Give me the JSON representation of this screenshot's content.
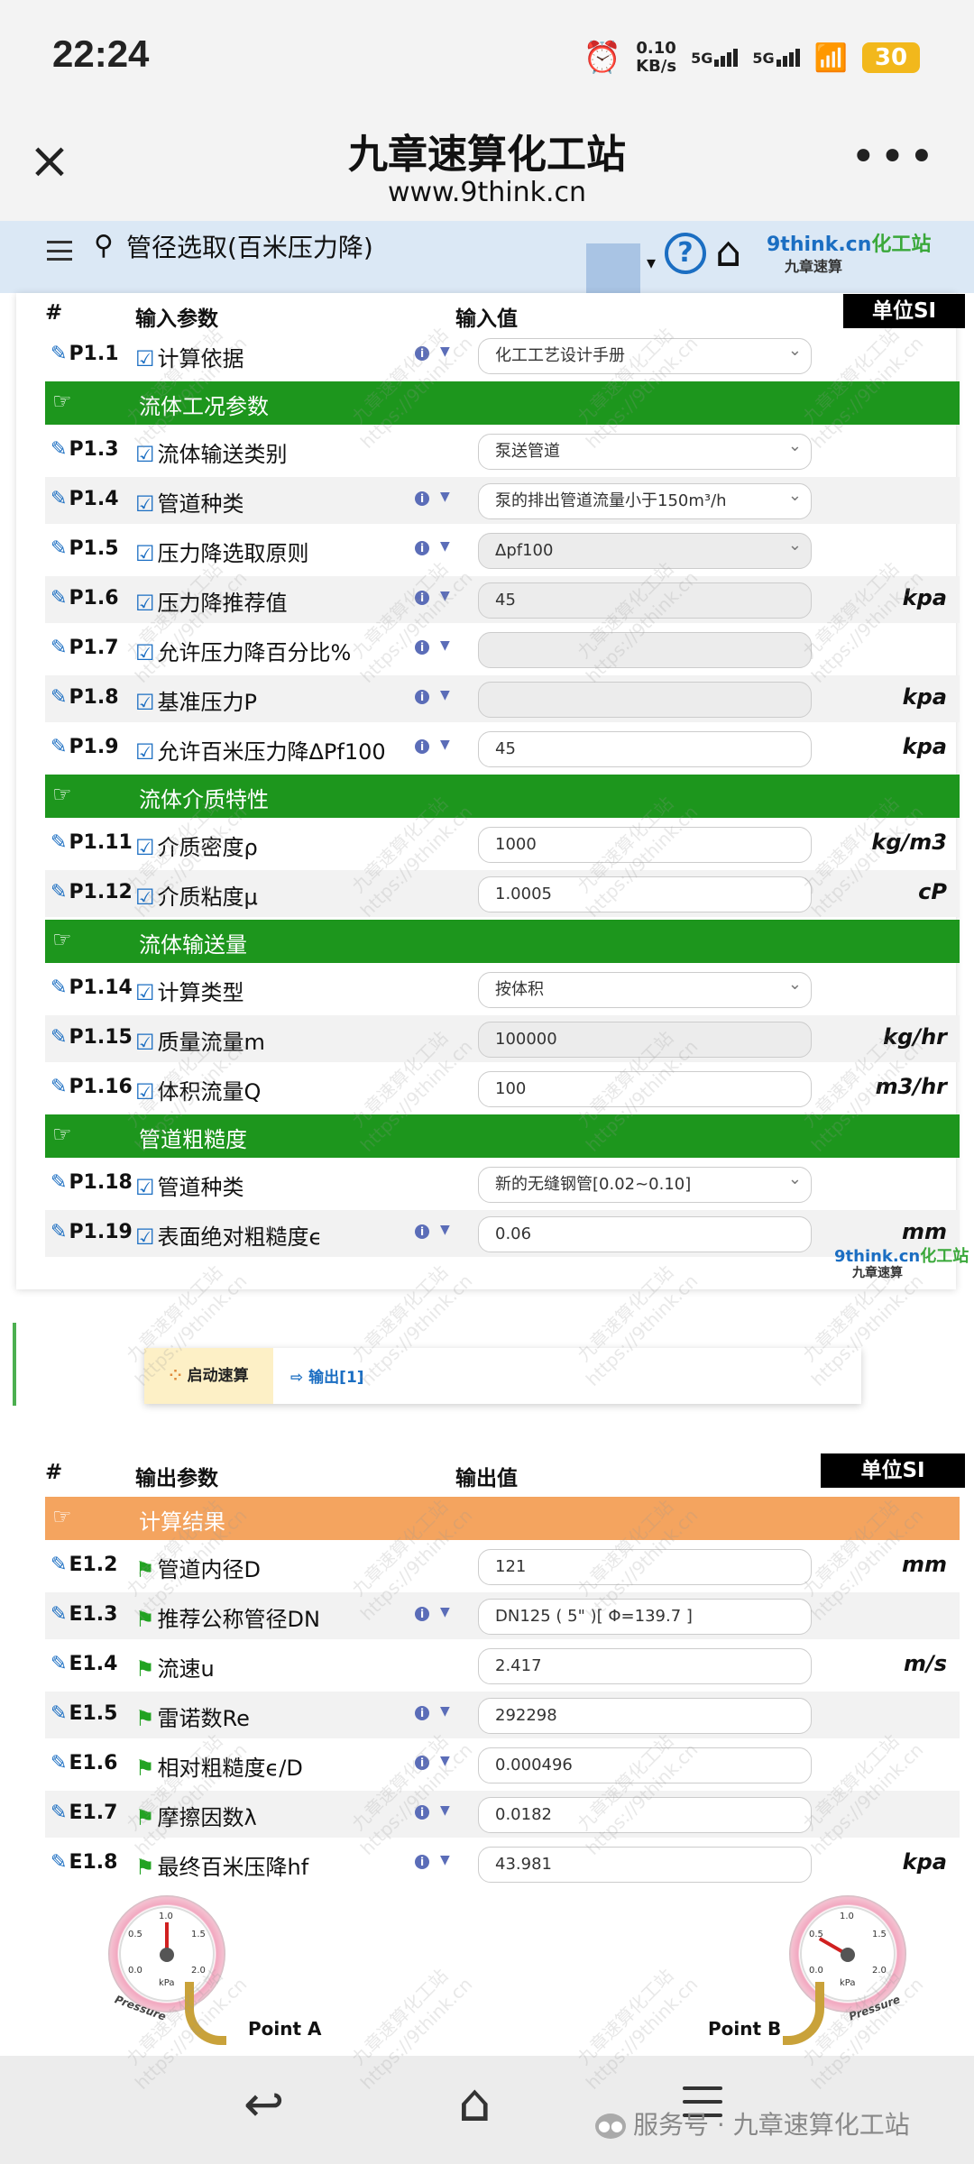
{
  "status": {
    "time": "22:24",
    "speed": "0.10",
    "speed_unit": "KB/s",
    "net1": "5G",
    "net2": "5G",
    "battery": "30"
  },
  "titlebar": {
    "title": "九章速算化工站",
    "subtitle": "www.9think.cn"
  },
  "appbar": {
    "title": "管径选取(百米压力降)",
    "logo_main": "9think.cn",
    "logo_suffix": "化工站",
    "logo_sub": "九章速算",
    "help": "?"
  },
  "input_header": {
    "col_id": "#",
    "col_param": "输入参数",
    "col_value": "输入值",
    "unit": "单位SI"
  },
  "inputs": [
    {
      "type": "row",
      "id": "P1.1",
      "name": "计算依据",
      "info": true,
      "value": "化工工艺设计手册",
      "select": true,
      "ro": false,
      "unit": ""
    },
    {
      "type": "section",
      "name": "流体工况参数"
    },
    {
      "type": "row",
      "id": "P1.3",
      "name": "流体输送类别",
      "info": false,
      "value": "泵送管道",
      "select": true,
      "ro": false,
      "unit": ""
    },
    {
      "type": "row",
      "id": "P1.4",
      "name": "管道种类",
      "info": true,
      "value": "泵的排出管道流量小于150m³/h",
      "select": true,
      "ro": false,
      "unit": ""
    },
    {
      "type": "row",
      "id": "P1.5",
      "name": "压力降选取原则",
      "info": true,
      "value": "Δpf100",
      "select": true,
      "ro": true,
      "unit": ""
    },
    {
      "type": "row",
      "id": "P1.6",
      "name": "压力降推荐值",
      "info": true,
      "value": "45",
      "select": false,
      "ro": true,
      "unit": "kpa"
    },
    {
      "type": "row",
      "id": "P1.7",
      "name": "允许压力降百分比%",
      "info": true,
      "value": "",
      "select": false,
      "ro": true,
      "unit": ""
    },
    {
      "type": "row",
      "id": "P1.8",
      "name": "基准压力P",
      "info": true,
      "value": "",
      "select": false,
      "ro": true,
      "unit": "kpa"
    },
    {
      "type": "row",
      "id": "P1.9",
      "name": "允许百米压力降ΔPf100",
      "info": true,
      "value": "45",
      "select": false,
      "ro": false,
      "unit": "kpa"
    },
    {
      "type": "section",
      "name": "流体介质特性"
    },
    {
      "type": "row",
      "id": "P1.11",
      "name": "介质密度ρ",
      "info": false,
      "value": "1000",
      "select": false,
      "ro": false,
      "unit": "kg/m3"
    },
    {
      "type": "row",
      "id": "P1.12",
      "name": "介质粘度μ",
      "info": false,
      "value": "1.0005",
      "select": false,
      "ro": false,
      "unit": "cP"
    },
    {
      "type": "section",
      "name": "流体输送量"
    },
    {
      "type": "row",
      "id": "P1.14",
      "name": "计算类型",
      "info": false,
      "value": "按体积",
      "select": true,
      "ro": false,
      "unit": ""
    },
    {
      "type": "row",
      "id": "P1.15",
      "name": "质量流量m",
      "info": false,
      "value": "100000",
      "select": false,
      "ro": true,
      "unit": "kg/hr"
    },
    {
      "type": "row",
      "id": "P1.16",
      "name": "体积流量Q",
      "info": false,
      "value": "100",
      "select": false,
      "ro": false,
      "unit": "m3/hr"
    },
    {
      "type": "section",
      "name": "管道粗糙度"
    },
    {
      "type": "row",
      "id": "P1.18",
      "name": "管道种类",
      "info": false,
      "value": "新的无缝钢管[0.02~0.10]",
      "select": true,
      "ro": false,
      "unit": ""
    },
    {
      "type": "row",
      "id": "P1.19",
      "name": "表面绝对粗糙度ϵ",
      "info": true,
      "value": "0.06",
      "select": false,
      "ro": false,
      "unit": "mm"
    }
  ],
  "actions": {
    "start": "启动速算",
    "output": "输出[1]"
  },
  "output_header": {
    "col_id": "#",
    "col_param": "输出参数",
    "col_value": "输出值",
    "unit": "单位SI"
  },
  "outputs": [
    {
      "type": "section",
      "name": "计算结果"
    },
    {
      "type": "row",
      "id": "E1.2",
      "name": "管道内径D",
      "info": false,
      "value": "121",
      "unit": "mm"
    },
    {
      "type": "row",
      "id": "E1.3",
      "name": "推荐公称管径DN",
      "info": true,
      "value": "DN125 ( 5\" )[ Φ=139.7 ]",
      "unit": ""
    },
    {
      "type": "row",
      "id": "E1.4",
      "name": "流速u",
      "info": false,
      "value": "2.417",
      "unit": "m/s"
    },
    {
      "type": "row",
      "id": "E1.5",
      "name": "雷诺数Re",
      "info": true,
      "value": "292298",
      "unit": ""
    },
    {
      "type": "row",
      "id": "E1.6",
      "name": "相对粗糙度ϵ/D",
      "info": true,
      "value": "0.000496",
      "unit": ""
    },
    {
      "type": "row",
      "id": "E1.7",
      "name": "摩擦因数λ",
      "info": true,
      "value": "0.0182",
      "unit": ""
    },
    {
      "type": "row",
      "id": "E1.8",
      "name": "最终百米压降hf",
      "info": true,
      "value": "43.981",
      "unit": "kpa"
    }
  ],
  "gauges": {
    "a": "Point A",
    "b": "Point B",
    "tag": "Pressure",
    "ticks": [
      "0.5",
      "1.0",
      "1.5",
      "2.0",
      "0.0"
    ],
    "unit": "kPa"
  },
  "watermark": {
    "text1": "九章速算化工站",
    "text2": "https://9think.cn"
  },
  "footer": {
    "service": "服务号 · 九章速算化工站"
  }
}
